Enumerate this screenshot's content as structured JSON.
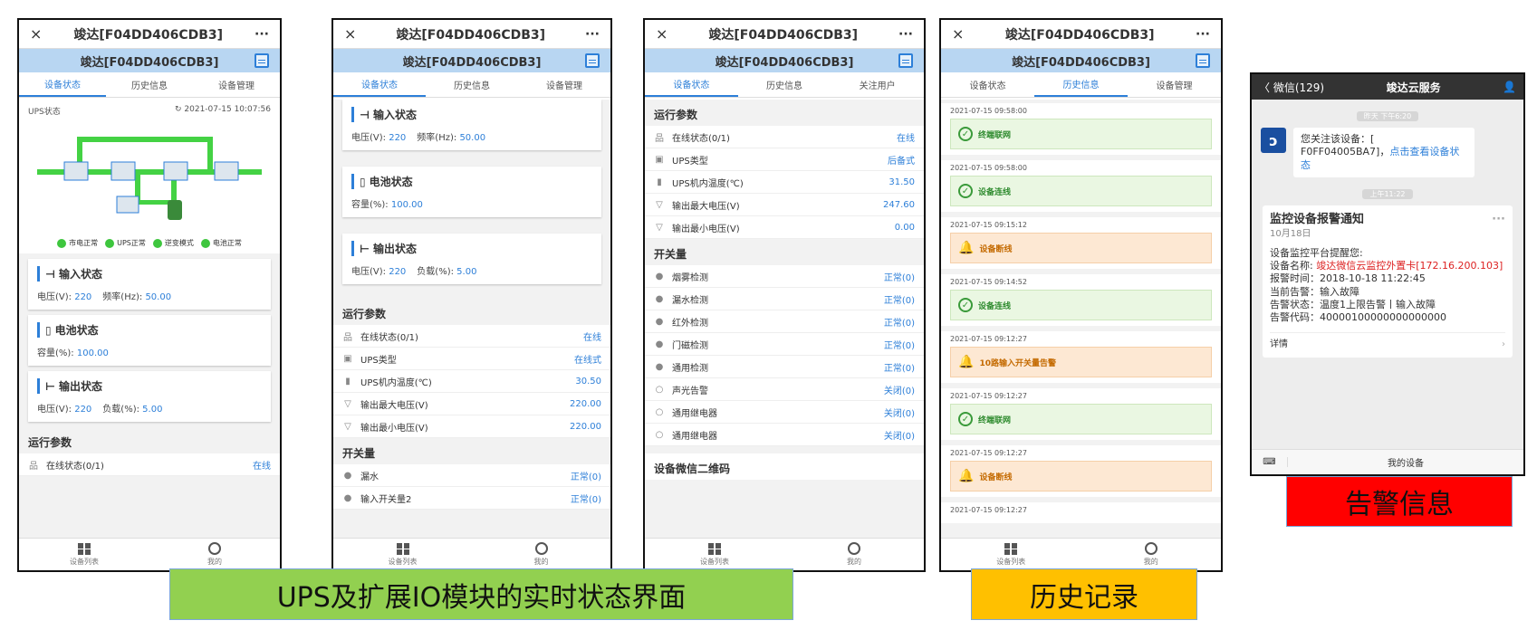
{
  "device_title": "竣达[F04DD406CDB3]",
  "more": "···",
  "close": "×",
  "tabs": {
    "status": "设备状态",
    "history": "历史信息",
    "manage": "设备管理",
    "users": "关注用户"
  },
  "nav": {
    "list": "设备列表",
    "mine": "我的"
  },
  "ups": {
    "label": "UPS状态",
    "time": "2021-07-15 10:07:56",
    "legend": [
      "市电正常",
      "UPS正常",
      "逆变模式",
      "电池正常"
    ]
  },
  "input": {
    "title": "输入状态",
    "v_label": "电压(V):",
    "v": "220",
    "f_label": "频率(Hz):",
    "f": "50.00"
  },
  "battery": {
    "title": "电池状态",
    "c_label": "容量(%):",
    "c": "100.00"
  },
  "output": {
    "title": "输出状态",
    "v_label": "电压(V):",
    "v": "220",
    "l_label": "负载(%):",
    "l": "5.00"
  },
  "run_params": "运行参数",
  "switch": "开关量",
  "p1_rows": [
    {
      "n": "在线状态(0/1)",
      "r": "在线"
    }
  ],
  "p2_rows": [
    {
      "n": "在线状态(0/1)",
      "r": "在线"
    },
    {
      "n": "UPS类型",
      "r": "在线式"
    },
    {
      "n": "UPS机内温度(℃)",
      "r": "30.50"
    },
    {
      "n": "输出最大电压(V)",
      "r": "220.00"
    },
    {
      "n": "输出最小电压(V)",
      "r": "220.00"
    }
  ],
  "p2_sw": [
    {
      "n": "漏水",
      "r": "正常(0)"
    },
    {
      "n": "输入开关量2",
      "r": "正常(0)"
    }
  ],
  "p3_rows": [
    {
      "n": "在线状态(0/1)",
      "r": "在线"
    },
    {
      "n": "UPS类型",
      "r": "后备式"
    },
    {
      "n": "UPS机内温度(℃)",
      "r": "31.50"
    },
    {
      "n": "输出最大电压(V)",
      "r": "247.60"
    },
    {
      "n": "输出最小电压(V)",
      "r": "0.00"
    }
  ],
  "p3_sw": [
    {
      "n": "烟雾检测",
      "r": "正常(0)"
    },
    {
      "n": "漏水检测",
      "r": "正常(0)"
    },
    {
      "n": "红外检测",
      "r": "正常(0)"
    },
    {
      "n": "门磁检测",
      "r": "正常(0)"
    },
    {
      "n": "通用检测",
      "r": "正常(0)"
    },
    {
      "n": "声光告警",
      "r": "关闭(0)"
    },
    {
      "n": "通用继电器",
      "r": "关闭(0)"
    },
    {
      "n": "通用继电器",
      "r": "关闭(0)"
    }
  ],
  "qr_section": "设备微信二维码",
  "history": [
    {
      "ts": "2021-07-15 09:58:00",
      "msg": "终端联网",
      "kind": "ok"
    },
    {
      "ts": "2021-07-15 09:58:00",
      "msg": "设备连线",
      "kind": "ok"
    },
    {
      "ts": "2021-07-15 09:15:12",
      "msg": "设备断线",
      "kind": "warn"
    },
    {
      "ts": "2021-07-15 09:14:52",
      "msg": "设备连线",
      "kind": "ok"
    },
    {
      "ts": "2021-07-15 09:12:27",
      "msg": "10路输入开关量告警",
      "kind": "warn"
    },
    {
      "ts": "2021-07-15 09:12:27",
      "msg": "终端联网",
      "kind": "ok"
    },
    {
      "ts": "2021-07-15 09:12:27",
      "msg": "设备断线",
      "kind": "warn"
    },
    {
      "ts": "2021-07-15 09:12:27",
      "msg": "",
      "kind": "ok"
    }
  ],
  "wechat": {
    "back": "〈 微信(129)",
    "title": "竣达云服务",
    "time1": "昨天 下午6:20",
    "msg1_a": "您关注该设备：[",
    "msg1_b": "F0FF04005BA7]，",
    "msg1_link": "点击查看设备状态",
    "time2": "上午11:22",
    "card_title": "监控设备报警通知",
    "card_date": "10月18日",
    "line1": "设备监控平台提醒您:",
    "name_label": "设备名称:",
    "name_val": "竣达微信云监控外置卡[172.16.200.103]",
    "time_line": "报警时间：2018-10-18 11:22:45",
    "alarm_line": "当前告警：输入故障",
    "state_line": "告警状态：温度1上限告警丨输入故障",
    "code_line": "告警代码：40000100000000000000",
    "detail": "详情",
    "bottom": "我的设备"
  },
  "banners": {
    "realtime": "UPS及扩展IO模块的实时状态界面",
    "history": "历史记录",
    "alarm": "告警信息"
  }
}
